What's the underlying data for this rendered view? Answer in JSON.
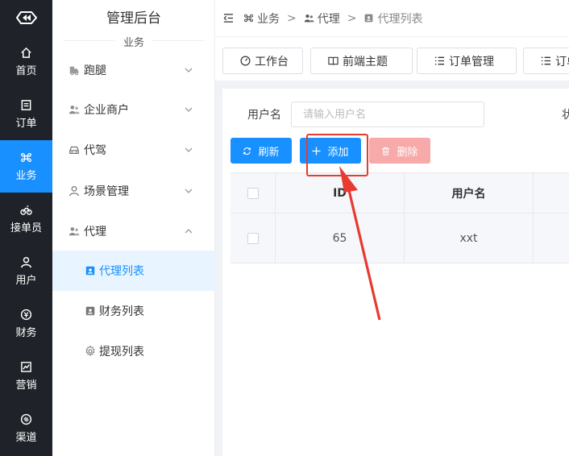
{
  "rail": {
    "items": [
      {
        "label": "首页",
        "icon": "home-icon"
      },
      {
        "label": "订单",
        "icon": "order-icon"
      },
      {
        "label": "业务",
        "icon": "business-icon",
        "active": true
      },
      {
        "label": "接单员",
        "icon": "courier-icon"
      },
      {
        "label": "用户",
        "icon": "user-icon"
      },
      {
        "label": "财务",
        "icon": "finance-icon"
      },
      {
        "label": "营销",
        "icon": "marketing-icon"
      },
      {
        "label": "渠道",
        "icon": "channel-icon"
      }
    ]
  },
  "sidebar": {
    "title": "管理后台",
    "section": "业务",
    "items": [
      {
        "label": "跑腿",
        "icon": "errand-icon",
        "expanded": false
      },
      {
        "label": "企业商户",
        "icon": "merchant-icon",
        "expanded": false
      },
      {
        "label": "代驾",
        "icon": "car-icon",
        "expanded": false
      },
      {
        "label": "场景管理",
        "icon": "scene-icon",
        "expanded": false
      },
      {
        "label": "代理",
        "icon": "agent-icon",
        "expanded": true
      }
    ],
    "sub_items": [
      {
        "label": "代理列表",
        "icon": "contact-card-icon",
        "active": true
      },
      {
        "label": "财务列表",
        "icon": "contact-card-icon"
      },
      {
        "label": "提现列表",
        "icon": "gear-icon"
      }
    ]
  },
  "breadcrumb": [
    "业务",
    "代理",
    "代理列表"
  ],
  "tabs": [
    {
      "label": "工作台",
      "icon": "dashboard-icon"
    },
    {
      "label": "前端主题",
      "icon": "book-icon"
    },
    {
      "label": "订单管理",
      "icon": "list-icon"
    },
    {
      "label": "订单",
      "icon": "list-icon"
    }
  ],
  "search": {
    "label": "用户名",
    "placeholder": "请输入用户名",
    "value": "",
    "next_label_partial": "状"
  },
  "toolbar": {
    "refresh": "刷新",
    "add": "添加",
    "delete": "删除"
  },
  "table": {
    "columns": [
      "ID",
      "用户名"
    ],
    "rows": [
      {
        "id": "65",
        "username": "xxt"
      }
    ]
  },
  "colors": {
    "primary": "#1890ff",
    "danger_disabled": "#f8a9a9",
    "rail_bg": "#1f2329",
    "annotation": "#e83a30"
  }
}
